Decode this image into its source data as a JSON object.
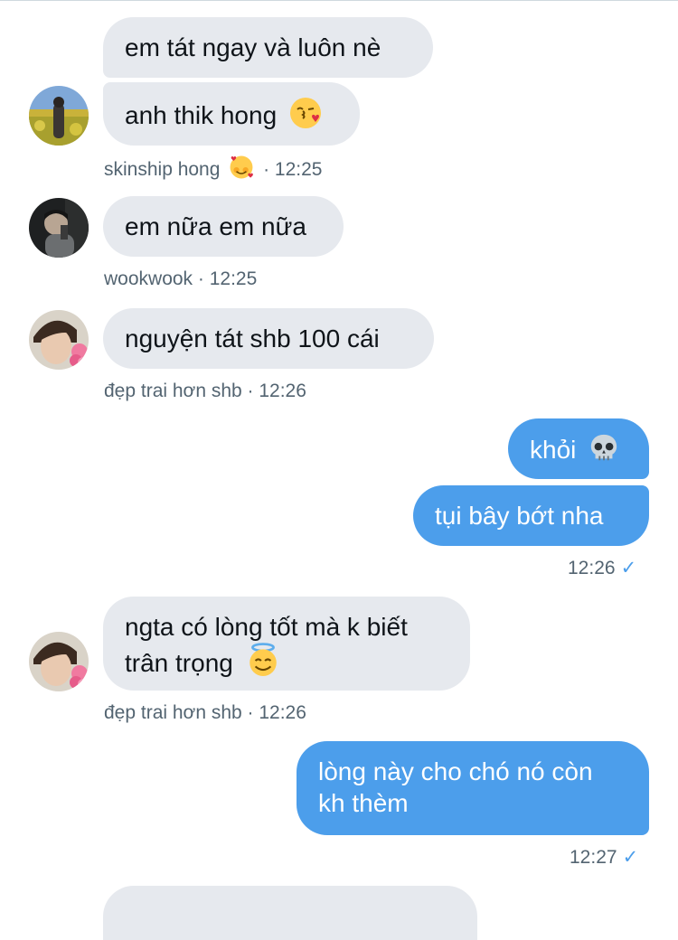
{
  "messages": {
    "m1": "em tát ngay và luôn nè",
    "m2": "anh thik hong",
    "m2_meta_name": "skinship hong",
    "m2_meta_time": "· 12:25",
    "m3": "em nữa em nữa",
    "m3_meta": "wookwook · 12:25",
    "m4": "nguyện tát shb 100 cái",
    "m4_meta": "đẹp trai hơn shb · 12:26",
    "m5": "khỏi",
    "m6": "tụi bây bớt nha",
    "m6_meta": "12:26",
    "m7_line1": "ngta có lòng tốt mà k biết",
    "m7_line2": "trân trọng",
    "m7_meta": "đẹp trai hơn shb · 12:26",
    "m8_line1": "lòng này cho chó nó còn",
    "m8_line2": "kh thèm",
    "m8_meta": "12:27",
    "check_mark": "✓"
  },
  "icons": {
    "m2": "kissing-face-emoji",
    "m2_meta": "smiling-face-with-hearts-emoji",
    "m5": "skull-emoji",
    "m7": "smiling-face-with-halo-emoji"
  },
  "colors": {
    "incoming_bubble": "#e6e9ee",
    "outgoing_bubble": "#4c9eeb",
    "meta_text": "#536471"
  }
}
